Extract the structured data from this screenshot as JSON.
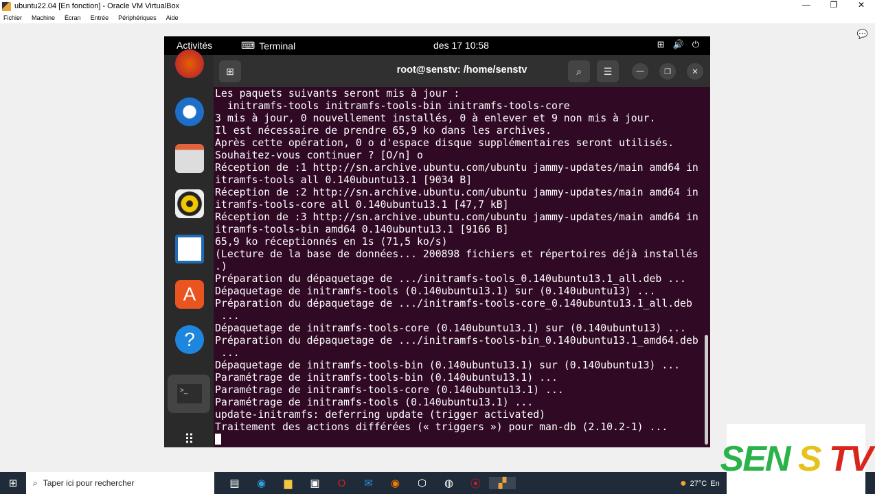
{
  "window": {
    "title": "ubuntu22.04 [En fonction] - Oracle VM VirtualBox",
    "controls": [
      "—",
      "❐",
      "✕"
    ]
  },
  "menu": [
    "Fichier",
    "Machine",
    "Écran",
    "Entrée",
    "Périphériques",
    "Aide"
  ],
  "gnome": {
    "activities": "Activités",
    "app": "Terminal",
    "clock": "des 17  10:58"
  },
  "terminal": {
    "title": "root@senstv: /home/senstv",
    "lines": [
      "Les paquets suivants seront mis à jour :",
      "  initramfs-tools initramfs-tools-bin initramfs-tools-core",
      "3 mis à jour, 0 nouvellement installés, 0 à enlever et 9 non mis à jour.",
      "Il est nécessaire de prendre 65,9 ko dans les archives.",
      "Après cette opération, 0 o d'espace disque supplémentaires seront utilisés.",
      "Souhaitez-vous continuer ? [O/n] o",
      "Réception de :1 http://sn.archive.ubuntu.com/ubuntu jammy-updates/main amd64 in",
      "itramfs-tools all 0.140ubuntu13.1 [9034 B]",
      "Réception de :2 http://sn.archive.ubuntu.com/ubuntu jammy-updates/main amd64 in",
      "itramfs-tools-core all 0.140ubuntu13.1 [47,7 kB]",
      "Réception de :3 http://sn.archive.ubuntu.com/ubuntu jammy-updates/main amd64 in",
      "itramfs-tools-bin amd64 0.140ubuntu13.1 [9166 B]",
      "65,9 ko réceptionnés en 1s (71,5 ko/s)",
      "(Lecture de la base de données... 200898 fichiers et répertoires déjà installés",
      ".)",
      "Préparation du dépaquetage de .../initramfs-tools_0.140ubuntu13.1_all.deb ...",
      "Dépaquetage de initramfs-tools (0.140ubuntu13.1) sur (0.140ubuntu13) ...",
      "Préparation du dépaquetage de .../initramfs-tools-core_0.140ubuntu13.1_all.deb",
      " ...",
      "Dépaquetage de initramfs-tools-core (0.140ubuntu13.1) sur (0.140ubuntu13) ...",
      "Préparation du dépaquetage de .../initramfs-tools-bin_0.140ubuntu13.1_amd64.deb",
      " ...",
      "Dépaquetage de initramfs-tools-bin (0.140ubuntu13.1) sur (0.140ubuntu13) ...",
      "Paramétrage de initramfs-tools-bin (0.140ubuntu13.1) ...",
      "Paramétrage de initramfs-tools-core (0.140ubuntu13.1) ...",
      "Paramétrage de initramfs-tools (0.140ubuntu13.1) ...",
      "update-initramfs: deferring update (trigger activated)",
      "Traitement des actions différées (« triggers ») pour man-db (2.10.2-1) ..."
    ]
  },
  "taskbar": {
    "search_placeholder": "Taper ici pour rechercher",
    "weather": "27°C",
    "weather_extra": "En"
  },
  "logo": {
    "a": "SEN",
    "b": "S",
    "c": "TV"
  }
}
